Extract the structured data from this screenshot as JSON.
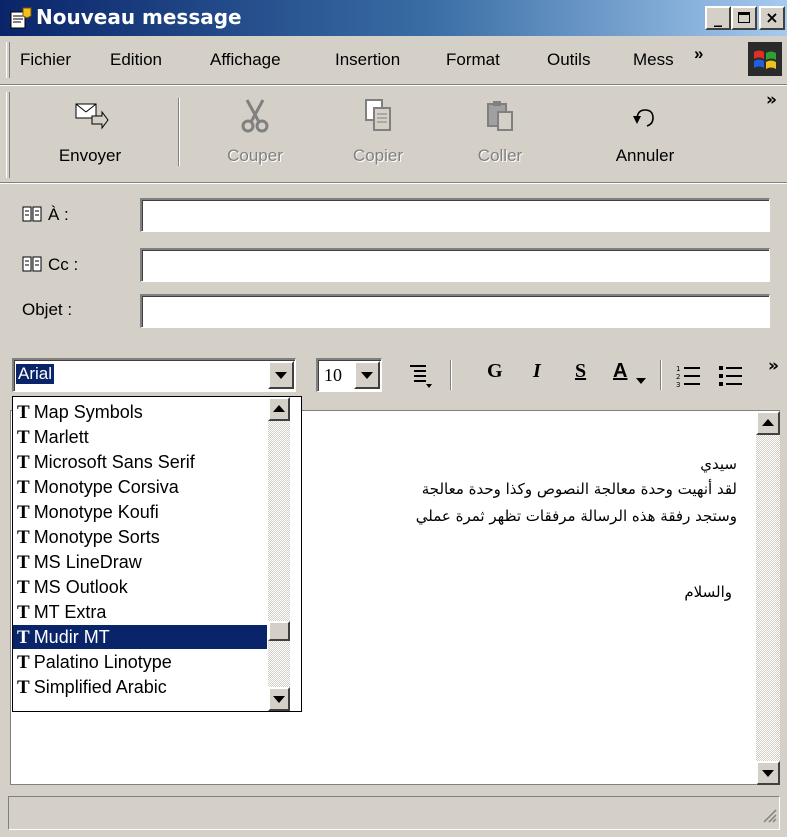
{
  "window": {
    "title": "Nouveau message",
    "minimize": "_",
    "close": "×"
  },
  "menu": {
    "items": [
      "Fichier",
      "Edition",
      "Affichage",
      "Insertion",
      "Format",
      "Outils",
      "Mess"
    ],
    "overflow": "»"
  },
  "toolbar": {
    "buttons": [
      {
        "label": "Envoyer",
        "icon": "send-icon",
        "enabled": true
      },
      {
        "label": "Couper",
        "icon": "scissors-icon",
        "enabled": false
      },
      {
        "label": "Copier",
        "icon": "copy-icon",
        "enabled": false
      },
      {
        "label": "Coller",
        "icon": "paste-icon",
        "enabled": false
      },
      {
        "label": "Annuler",
        "icon": "undo-icon",
        "enabled": true
      }
    ],
    "overflow": "»"
  },
  "fields": {
    "to_label": "À :",
    "cc_label": "Cc :",
    "subject_label": "Objet :",
    "to_value": "",
    "cc_value": "",
    "subject_value": ""
  },
  "format": {
    "font": "Arial",
    "size": "10",
    "bold": "G",
    "italic": "I",
    "underline": "S",
    "color": "A",
    "overflow": "»"
  },
  "font_list": {
    "items": [
      "Map Symbols",
      "Marlett",
      "Microsoft Sans Serif",
      "Monotype Corsiva",
      "Monotype Koufi",
      "Monotype Sorts",
      "MS LineDraw",
      "MS Outlook",
      "MT Extra",
      "Mudir MT",
      "Palatino Linotype",
      "Simplified Arabic"
    ],
    "selected": "Mudir MT",
    "item_glyph": "T"
  },
  "body": {
    "lines": [
      "سيدي",
      "لقد أنهيت وحدة معالجة النصوص وكذا وحدة معالجة",
      "وستجد رفقة هذه الرسالة مرفقات تظهر ثمرة عملي",
      "والسلام"
    ]
  },
  "colors": {
    "title_gradient_start": "#0a246a",
    "title_gradient_end": "#a6caf0",
    "selection": "#0a246a",
    "chrome": "#d4d0c8"
  }
}
